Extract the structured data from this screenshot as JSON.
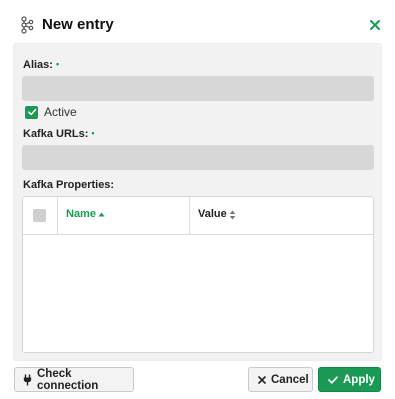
{
  "dialog": {
    "title": "New entry"
  },
  "form": {
    "alias": {
      "label": "Alias:",
      "required_mark": "•",
      "value": ""
    },
    "active": {
      "label": "Active",
      "checked": true
    },
    "kafka_urls": {
      "label": "Kafka URLs:",
      "required_mark": "•",
      "value": ""
    },
    "kafka_properties": {
      "label": "Kafka Properties:",
      "columns": [
        {
          "label": "Name",
          "sort": "ascending"
        },
        {
          "label": "Value",
          "sort": "none"
        }
      ],
      "rows": []
    }
  },
  "footer": {
    "check_connection_label": "Check connection",
    "cancel_label": "Cancel",
    "apply_label": "Apply"
  },
  "colors": {
    "accent": "#1b9a55",
    "panel_bg": "#f2f2f2",
    "input_bg": "#d7d7d7"
  }
}
